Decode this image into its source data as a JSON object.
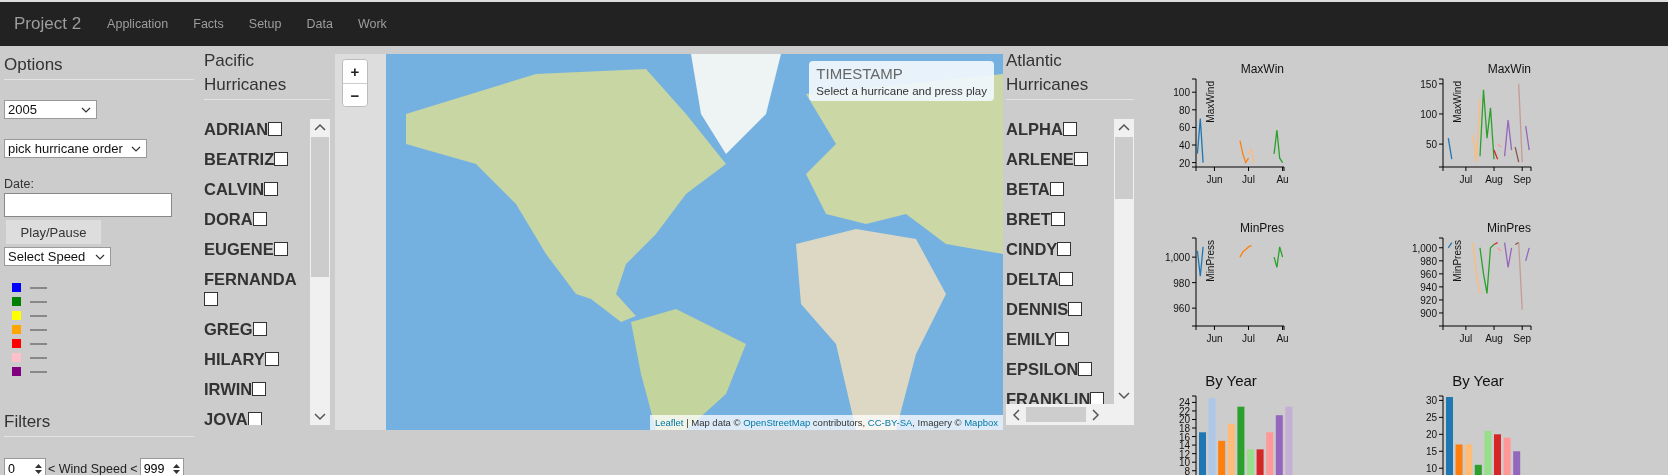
{
  "navbar": {
    "brand": "Project 2",
    "links": [
      {
        "label": "Application"
      },
      {
        "label": "Facts"
      },
      {
        "label": "Setup"
      },
      {
        "label": "Data"
      },
      {
        "label": "Work"
      }
    ]
  },
  "options": {
    "heading": "Options",
    "year_select": {
      "value": "2005"
    },
    "order_select": {
      "value": "pick hurricane order"
    },
    "date_field": {
      "label": "Date:"
    },
    "play_button": "Play/Pause",
    "speed_select": {
      "value": "Select Speed"
    },
    "legend": [
      {
        "color": "#0000ff"
      },
      {
        "color": "#008000"
      },
      {
        "color": "#ffff00"
      },
      {
        "color": "#ffa500"
      },
      {
        "color": "#ff0000"
      },
      {
        "color": "#ffc0cb"
      },
      {
        "color": "#800080"
      }
    ]
  },
  "filters": {
    "heading": "Filters",
    "min_wind": {
      "value": "0"
    },
    "wind_label": "< Wind Speed <",
    "max_wind": {
      "value": "999"
    }
  },
  "pacific": {
    "heading": "Pacific Hurricanes",
    "hurricanes": [
      {
        "name": "ADRIAN",
        "checked": false
      },
      {
        "name": "BEATRIZ",
        "checked": false
      },
      {
        "name": "CALVIN",
        "checked": false
      },
      {
        "name": "DORA",
        "checked": false
      },
      {
        "name": "EUGENE",
        "checked": false
      },
      {
        "name": "FERNANDA",
        "checked": false
      },
      {
        "name": "GREG",
        "checked": false
      },
      {
        "name": "HILARY",
        "checked": false
      },
      {
        "name": "IRWIN",
        "checked": false
      },
      {
        "name": "JOVA",
        "checked": false
      }
    ]
  },
  "map": {
    "zoom_in": "+",
    "zoom_out": "−",
    "timestamp": {
      "title": "TIMESTAMP",
      "message": "Select a hurricane and press play"
    },
    "attribution": [
      {
        "kind": "link",
        "text": "Leaflet"
      },
      {
        "kind": "text",
        "text": " | Map data © "
      },
      {
        "kind": "link",
        "text": "OpenStreetMap"
      },
      {
        "kind": "text",
        "text": " contributors, "
      },
      {
        "kind": "link",
        "text": "CC-BY-SA"
      },
      {
        "kind": "text",
        "text": ", Imagery © "
      },
      {
        "kind": "link",
        "text": "Mapbox"
      }
    ]
  },
  "atlantic": {
    "heading": "Atlantic Hurricanes",
    "hurricanes": [
      {
        "name": "ALPHA",
        "checked": false
      },
      {
        "name": "ARLENE",
        "checked": false
      },
      {
        "name": "BETA",
        "checked": false
      },
      {
        "name": "BRET",
        "checked": false
      },
      {
        "name": "CINDY",
        "checked": false
      },
      {
        "name": "DELTA",
        "checked": false
      },
      {
        "name": "DENNIS",
        "checked": false
      },
      {
        "name": "EMILY",
        "checked": false
      },
      {
        "name": "EPSILON",
        "checked": false
      },
      {
        "name": "FRANKLIN",
        "checked": false
      }
    ]
  },
  "charts": [
    {
      "chart_data": {
        "type": "line",
        "title": "MaxWin",
        "ylabel": "MaxWind",
        "categories": [
          null,
          null,
          null,
          null,
          null,
          null,
          "Jun",
          null,
          null,
          null,
          null,
          null,
          null,
          null,
          null,
          null,
          null,
          null,
          "Jul",
          null,
          null,
          null,
          null,
          null,
          null,
          null,
          null,
          null,
          null,
          null,
          "Au"
        ],
        "ylim": [
          15,
          115
        ],
        "yticks": [
          20,
          40,
          60,
          80,
          100
        ],
        "series": [
          {
            "color": "#1f77b4",
            "values": [
              30,
              70,
              20,
              null,
              null,
              null,
              null,
              null,
              null,
              null,
              null,
              null,
              null,
              null,
              null,
              null,
              null,
              null,
              null,
              null,
              null,
              null,
              null,
              null,
              null,
              null,
              null,
              null,
              null,
              null,
              null
            ]
          },
          {
            "color": "#ff7f0e",
            "values": [
              null,
              null,
              null,
              null,
              null,
              null,
              null,
              null,
              null,
              null,
              null,
              null,
              null,
              null,
              null,
              45,
              30,
              20,
              25,
              null,
              null,
              null,
              null,
              null,
              null,
              null,
              null,
              null,
              null,
              null,
              null
            ]
          },
          {
            "color": "#ffbb78",
            "values": [
              null,
              null,
              null,
              null,
              null,
              null,
              null,
              null,
              null,
              null,
              null,
              null,
              null,
              null,
              null,
              null,
              null,
              null,
              30,
              35,
              20,
              null,
              null,
              null,
              null,
              null,
              null,
              null,
              null,
              null,
              null
            ]
          },
          {
            "color": "#2ca02c",
            "values": [
              null,
              null,
              null,
              null,
              null,
              null,
              null,
              null,
              null,
              null,
              null,
              null,
              null,
              null,
              null,
              null,
              null,
              null,
              null,
              null,
              null,
              null,
              null,
              null,
              null,
              null,
              null,
              30,
              57,
              25,
              20
            ]
          }
        ]
      }
    },
    {
      "chart_data": {
        "type": "line",
        "title": "MaxWin",
        "ylabel": "MaxWind",
        "categories": [
          null,
          null,
          null,
          null,
          null,
          null,
          "Jul",
          null,
          null,
          null,
          null,
          null,
          null,
          null,
          "Aug",
          null,
          null,
          null,
          null,
          null,
          null,
          null,
          "Sep",
          null,
          null
        ],
        "ylim": [
          12,
          158
        ],
        "yticks": [
          50,
          100,
          150
        ],
        "series": [
          {
            "color": "#1f77b4",
            "values": [
              null,
              60,
              25,
              null,
              null,
              null,
              null,
              null,
              null,
              null,
              null,
              null,
              null,
              null,
              null,
              null,
              null,
              null,
              null,
              null,
              null,
              null,
              null,
              null,
              null
            ]
          },
          {
            "color": "#ffbb78",
            "values": [
              null,
              null,
              null,
              null,
              null,
              null,
              null,
              null,
              65,
              20,
              125,
              null,
              null,
              null,
              null,
              null,
              null,
              null,
              null,
              null,
              null,
              null,
              null,
              null,
              null
            ]
          },
          {
            "color": "#2ca02c",
            "values": [
              null,
              null,
              null,
              null,
              null,
              null,
              null,
              null,
              null,
              null,
              30,
              140,
              60,
              110,
              25,
              null,
              null,
              null,
              null,
              null,
              null,
              null,
              null,
              null,
              null
            ]
          },
          {
            "color": "#d62728",
            "values": [
              null,
              null,
              null,
              null,
              null,
              null,
              null,
              null,
              null,
              null,
              null,
              null,
              null,
              null,
              40,
              25,
              null,
              null,
              null,
              null,
              null,
              null,
              null,
              null,
              null
            ]
          },
          {
            "color": "#ff9896",
            "values": [
              null,
              null,
              null,
              null,
              null,
              null,
              null,
              null,
              null,
              null,
              null,
              null,
              null,
              null,
              null,
              50,
              45,
              null,
              null,
              null,
              null,
              null,
              null,
              null,
              null
            ]
          },
          {
            "color": "#9467bd",
            "values": [
              null,
              null,
              null,
              null,
              null,
              null,
              null,
              null,
              null,
              null,
              null,
              null,
              null,
              null,
              null,
              null,
              null,
              30,
              90,
              40,
              null,
              null,
              null,
              80,
              40
            ]
          },
          {
            "color": "#8c564b",
            "values": [
              null,
              null,
              null,
              null,
              null,
              null,
              null,
              null,
              null,
              null,
              null,
              null,
              null,
              null,
              null,
              null,
              null,
              null,
              null,
              null,
              45,
              20,
              null,
              null,
              null
            ]
          },
          {
            "color": "#c49c94",
            "values": [
              null,
              null,
              null,
              null,
              null,
              null,
              null,
              null,
              null,
              null,
              null,
              null,
              null,
              null,
              null,
              null,
              null,
              null,
              null,
              null,
              null,
              150,
              20,
              null,
              null
            ]
          }
        ]
      }
    },
    {
      "chart_data": {
        "type": "line",
        "title": "MinPres",
        "ylabel": "MinPress",
        "categories": [
          null,
          null,
          null,
          null,
          null,
          null,
          "Jun",
          null,
          null,
          null,
          null,
          null,
          null,
          null,
          null,
          null,
          null,
          null,
          "Jul",
          null,
          null,
          null,
          null,
          null,
          null,
          null,
          null,
          null,
          null,
          null,
          "Au"
        ],
        "ylim": [
          946,
          1015
        ],
        "yticks": [
          960,
          980,
          {
            "value": 1000,
            "label": "1,000"
          }
        ],
        "series": [
          {
            "color": "#1f77b4",
            "values": [
              1005,
              985,
              1008,
              null,
              null,
              null,
              null,
              null,
              null,
              null,
              null,
              null,
              null,
              null,
              null,
              null,
              null,
              null,
              null,
              null,
              null,
              null,
              null,
              null,
              null,
              null,
              null,
              null,
              null,
              null,
              null
            ]
          },
          {
            "color": "#ff7f0e",
            "values": [
              null,
              null,
              null,
              null,
              null,
              null,
              null,
              null,
              null,
              null,
              null,
              null,
              null,
              null,
              null,
              1000,
              1004,
              1006,
              1008,
              1009,
              null,
              null,
              null,
              null,
              null,
              null,
              null,
              null,
              null,
              null,
              null
            ]
          },
          {
            "color": "#2ca02c",
            "values": [
              null,
              null,
              null,
              null,
              null,
              null,
              null,
              null,
              null,
              null,
              null,
              null,
              null,
              null,
              null,
              null,
              null,
              null,
              null,
              null,
              null,
              null,
              null,
              null,
              null,
              null,
              null,
              1000,
              992,
              1008,
              1000
            ]
          }
        ]
      }
    },
    {
      "chart_data": {
        "type": "line",
        "title": "MinPres",
        "ylabel": "MinPress",
        "categories": [
          null,
          null,
          null,
          null,
          null,
          null,
          "Jul",
          null,
          null,
          null,
          null,
          null,
          null,
          null,
          "Aug",
          null,
          null,
          null,
          null,
          null,
          null,
          null,
          "Sep",
          null,
          null
        ],
        "ylim": [
          880,
          1015
        ],
        "yticks": [
          900,
          920,
          940,
          960,
          980,
          {
            "value": 1000,
            "label": "1,000"
          }
        ],
        "series": [
          {
            "color": "#1f77b4",
            "values": [
              null,
              1000,
              1008,
              null,
              null,
              null,
              null,
              null,
              null,
              null,
              null,
              null,
              null,
              null,
              null,
              null,
              null,
              null,
              null,
              null,
              null,
              null,
              null,
              null,
              null
            ]
          },
          {
            "color": "#ffbb78",
            "values": [
              null,
              null,
              null,
              null,
              null,
              null,
              null,
              null,
              1008,
              960,
              930,
              null,
              null,
              null,
              null,
              null,
              null,
              null,
              null,
              null,
              null,
              null,
              null,
              null,
              null
            ]
          },
          {
            "color": "#2ca02c",
            "values": [
              null,
              null,
              null,
              null,
              null,
              null,
              null,
              null,
              null,
              null,
              1000,
              960,
              930,
              1000,
              1005,
              null,
              null,
              null,
              null,
              null,
              null,
              null,
              null,
              null,
              null
            ]
          },
          {
            "color": "#d62728",
            "values": [
              null,
              null,
              null,
              null,
              null,
              null,
              null,
              null,
              null,
              null,
              null,
              null,
              null,
              null,
              1005,
              1008,
              null,
              null,
              null,
              null,
              null,
              null,
              null,
              null,
              null
            ]
          },
          {
            "color": "#ff9896",
            "values": [
              null,
              null,
              null,
              null,
              null,
              null,
              null,
              null,
              null,
              null,
              null,
              null,
              null,
              null,
              null,
              1000,
              995,
              null,
              null,
              null,
              null,
              null,
              null,
              null,
              null
            ]
          },
          {
            "color": "#9467bd",
            "values": [
              null,
              null,
              null,
              null,
              null,
              null,
              null,
              null,
              null,
              null,
              null,
              null,
              null,
              null,
              null,
              null,
              null,
              1008,
              970,
              1000,
              null,
              null,
              null,
              980,
              1000
            ]
          },
          {
            "color": "#8c564b",
            "values": [
              null,
              null,
              null,
              null,
              null,
              null,
              null,
              null,
              null,
              null,
              null,
              null,
              null,
              null,
              null,
              null,
              null,
              null,
              null,
              null,
              1005,
              1008,
              null,
              null,
              null
            ]
          },
          {
            "color": "#c49c94",
            "values": [
              null,
              null,
              null,
              null,
              null,
              null,
              null,
              null,
              null,
              null,
              null,
              null,
              null,
              null,
              null,
              null,
              null,
              null,
              null,
              null,
              null,
              1008,
              905,
              null,
              null
            ]
          }
        ]
      }
    },
    {
      "chart_data": {
        "type": "bar",
        "title": "By Year",
        "categories": [
          null,
          null,
          null,
          null,
          null,
          null,
          null,
          null,
          null,
          null
        ],
        "ylim": [
          7,
          25.5
        ],
        "yticks": [
          8,
          10,
          12,
          14,
          16,
          18,
          20,
          22,
          24
        ],
        "values": [
          17,
          25,
          15,
          19,
          23,
          13,
          13,
          17,
          21,
          23
        ],
        "colors": [
          "#1f77b4",
          "#aec7e8",
          "#ff7f0e",
          "#ffbb78",
          "#2ca02c",
          "#98df8a",
          "#d62728",
          "#ff9896",
          "#9467bd",
          "#c5b0d5"
        ]
      }
    },
    {
      "chart_data": {
        "type": "bar",
        "title": "By Year",
        "categories": [
          null,
          null,
          null,
          null,
          null,
          null,
          null,
          null
        ],
        "ylim": [
          8,
          31.3
        ],
        "yticks": [
          10,
          15,
          20,
          25,
          30
        ],
        "values": [
          31,
          17,
          17,
          11,
          21,
          20,
          19,
          15
        ],
        "colors": [
          "#1f77b4",
          "#ff7f0e",
          "#ffbb78",
          "#2ca02c",
          "#98df8a",
          "#d62728",
          "#ff9896",
          "#9467bd"
        ]
      }
    }
  ]
}
